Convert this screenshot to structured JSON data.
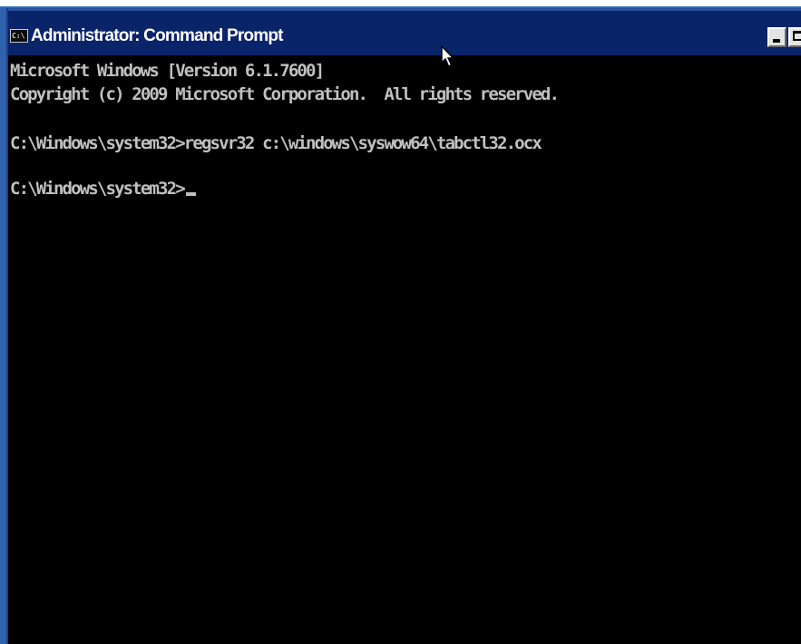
{
  "window": {
    "title": "Administrator: Command Prompt",
    "icon_text": "C:\\"
  },
  "console": {
    "lines": [
      "Microsoft Windows [Version 6.1.7600]",
      "Copyright (c) 2009 Microsoft Corporation.  All rights reserved.",
      "",
      "C:\\Windows\\system32>regsvr32 c:\\windows\\syswow64\\tabctl32.ocx",
      "",
      "C:\\Windows\\system32>"
    ]
  },
  "icons": {
    "app": "console-app-icon",
    "minimize": "minimize-icon",
    "maximize": "maximize-icon",
    "pointer": "mouse-pointer-icon"
  },
  "colors": {
    "titlebar": "#0a246a",
    "console_background": "#000000",
    "console_text": "#c0c0c0",
    "window_border": "#2f62ad"
  }
}
